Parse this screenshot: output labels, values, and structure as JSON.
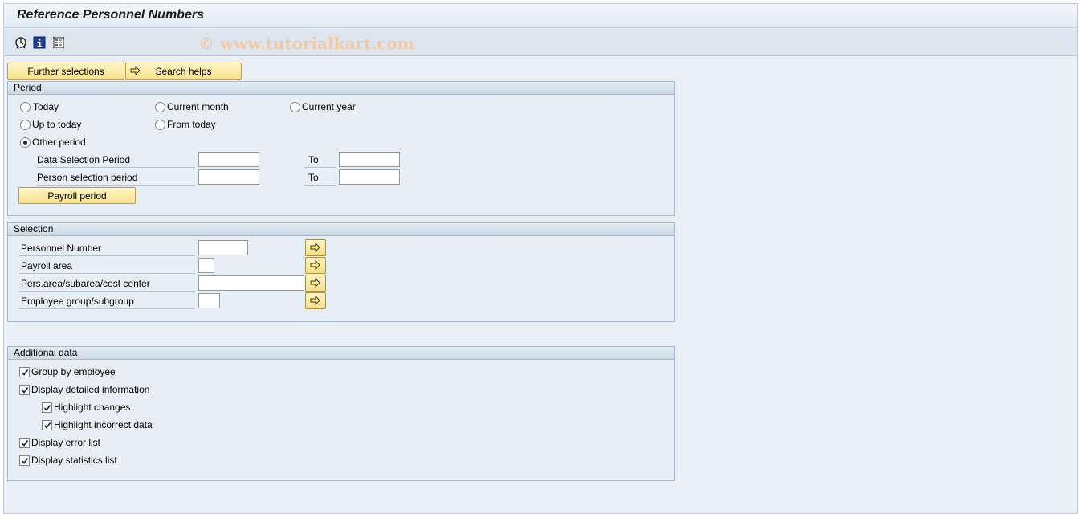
{
  "header": {
    "title": "Reference Personnel Numbers"
  },
  "toolbar": {
    "icons": [
      "execute-icon",
      "info-icon",
      "layout-icon"
    ],
    "watermark": "© www.tutorialkart.com"
  },
  "buttons": {
    "further_selections": "Further selections",
    "search_helps": "Search helps",
    "payroll_period": "Payroll period"
  },
  "period": {
    "title": "Period",
    "options": {
      "today": "Today",
      "current_month": "Current month",
      "current_year": "Current year",
      "up_to_today": "Up to today",
      "from_today": "From today",
      "other_period": "Other period"
    },
    "selected": "other_period",
    "data_selection_label": "Data Selection Period",
    "person_selection_label": "Person selection period",
    "to_label": "To",
    "data_selection_from": "",
    "data_selection_to": "",
    "person_selection_from": "",
    "person_selection_to": ""
  },
  "selection": {
    "title": "Selection",
    "fields": {
      "personnel_number": {
        "label": "Personnel Number",
        "value": ""
      },
      "payroll_area": {
        "label": "Payroll area",
        "value": ""
      },
      "pers_area": {
        "label": "Pers.area/subarea/cost center",
        "value": ""
      },
      "employee_group": {
        "label": "Employee group/subgroup",
        "value": ""
      }
    }
  },
  "additional": {
    "title": "Additional data",
    "options": {
      "group_by_employee": {
        "label": "Group by employee",
        "checked": true
      },
      "display_detailed": {
        "label": "Display detailed information",
        "checked": true
      },
      "highlight_changes": {
        "label": "Highlight changes",
        "checked": true
      },
      "highlight_incorrect": {
        "label": "Highlight incorrect data",
        "checked": true
      },
      "display_error_list": {
        "label": "Display error list",
        "checked": true
      },
      "display_statistics": {
        "label": "Display statistics list",
        "checked": true
      }
    }
  },
  "colors": {
    "background": "#eaeff6",
    "button": "#f9e28e",
    "group_header": "#cdd9e6"
  }
}
